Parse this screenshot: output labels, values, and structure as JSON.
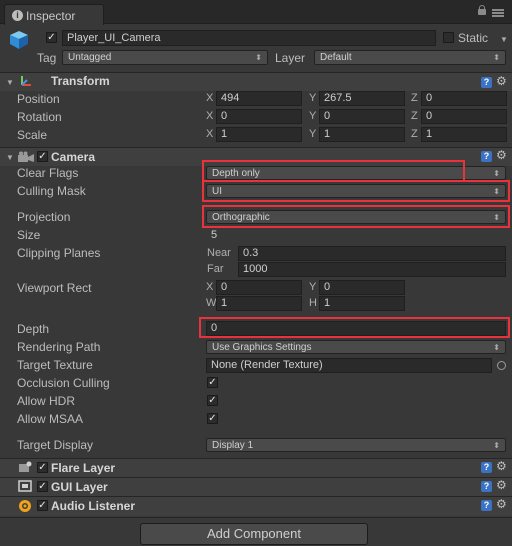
{
  "tab": {
    "title": "Inspector"
  },
  "gameobject": {
    "name": "Player_UI_Camera",
    "static_label": "Static",
    "tag_label": "Tag",
    "tag_value": "Untagged",
    "layer_label": "Layer",
    "layer_value": "Default"
  },
  "transform": {
    "title": "Transform",
    "position_label": "Position",
    "rotation_label": "Rotation",
    "scale_label": "Scale",
    "x": "X",
    "y": "Y",
    "z": "Z",
    "position": {
      "x": "494",
      "y": "267.5",
      "z": "0"
    },
    "rotation": {
      "x": "0",
      "y": "0",
      "z": "0"
    },
    "scale": {
      "x": "1",
      "y": "1",
      "z": "1"
    }
  },
  "camera": {
    "title": "Camera",
    "clear_flags_label": "Clear Flags",
    "clear_flags_value": "Depth only",
    "culling_mask_label": "Culling Mask",
    "culling_mask_value": "UI",
    "projection_label": "Projection",
    "projection_value": "Orthographic",
    "size_label": "Size",
    "size_value": "5",
    "clipping_label": "Clipping Planes",
    "near_label": "Near",
    "near_value": "0.3",
    "far_label": "Far",
    "far_value": "1000",
    "viewport_label": "Viewport Rect",
    "vp_x_label": "X",
    "vp_x": "0",
    "vp_y_label": "Y",
    "vp_y": "0",
    "vp_w_label": "W",
    "vp_w": "1",
    "vp_h_label": "H",
    "vp_h": "1",
    "depth_label": "Depth",
    "depth_value": "0",
    "rendering_path_label": "Rendering Path",
    "rendering_path_value": "Use Graphics Settings",
    "target_texture_label": "Target Texture",
    "target_texture_value": "None (Render Texture)",
    "occlusion_label": "Occlusion Culling",
    "hdr_label": "Allow HDR",
    "msaa_label": "Allow MSAA",
    "target_display_label": "Target Display",
    "target_display_value": "Display 1"
  },
  "components": {
    "flare_layer": "Flare Layer",
    "gui_layer": "GUI Layer",
    "audio_listener": "Audio Listener"
  },
  "add_component_label": "Add Component",
  "colors": {
    "highlight": "#e8323c",
    "help_blue": "#3b72c4"
  }
}
